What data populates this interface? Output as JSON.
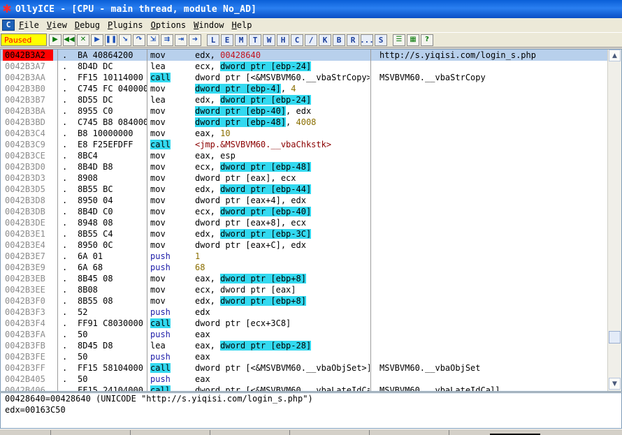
{
  "window": {
    "app_name": "OllyICE",
    "title": "OllyICE - [CPU - main thread, module No_AD]"
  },
  "menu": [
    {
      "label": "File",
      "u": "F",
      "rest": "ile"
    },
    {
      "label": "View",
      "u": "V",
      "rest": "iew"
    },
    {
      "label": "Debug",
      "u": "D",
      "rest": "ebug"
    },
    {
      "label": "Plugins",
      "u": "P",
      "rest": "lugins"
    },
    {
      "label": "Options",
      "u": "O",
      "rest": "ptions"
    },
    {
      "label": "Window",
      "u": "W",
      "rest": "indow"
    },
    {
      "label": "Help",
      "u": "H",
      "rest": "elp"
    }
  ],
  "toolbar": {
    "status": "Paused",
    "buttons": [
      {
        "name": "open-icon",
        "glyph": "▶"
      },
      {
        "name": "restart-icon",
        "glyph": "◀◀"
      },
      {
        "name": "close-icon",
        "glyph": "✕"
      },
      {
        "name": "run-icon",
        "glyph": "▶"
      },
      {
        "name": "pause-icon",
        "glyph": "❚❚"
      },
      {
        "name": "step-into-icon",
        "glyph": "↘"
      },
      {
        "name": "step-over-icon",
        "glyph": "↷"
      },
      {
        "name": "trace-into-icon",
        "glyph": "⇲"
      },
      {
        "name": "trace-over-icon",
        "glyph": "⇉"
      },
      {
        "name": "execute-till-return-icon",
        "glyph": "⇥"
      },
      {
        "name": "goto-icon",
        "glyph": "➜"
      }
    ],
    "letter_buttons": [
      "L",
      "E",
      "M",
      "T",
      "W",
      "H",
      "C",
      "/",
      "K",
      "B",
      "R",
      "...",
      "S"
    ],
    "extra_buttons": [
      {
        "name": "list-icon",
        "glyph": "☰"
      },
      {
        "name": "grid-icon",
        "glyph": "▦"
      },
      {
        "name": "help-icon",
        "glyph": "?"
      }
    ]
  },
  "disasm": [
    {
      "addr": "0042B3A2",
      "mark": ".",
      "hex": "BA 40864200",
      "mn": "mov",
      "ops": [
        {
          "t": "edx, "
        },
        {
          "t": "00428640",
          "c": "num"
        }
      ],
      "comment": "http://s.yiqisi.com/login_s.php",
      "selected": true
    },
    {
      "addr": "0042B3A7",
      "mark": ".",
      "hex": "8D4D DC",
      "mn": "lea",
      "ops": [
        {
          "t": "ecx, "
        },
        {
          "t": "dword ptr [ebp-24]",
          "c": "hl"
        }
      ],
      "comment": ""
    },
    {
      "addr": "0042B3AA",
      "mark": ".",
      "hex": "FF15 10114000",
      "mn": "call",
      "mnc": "call-mn",
      "ops": [
        {
          "t": "dword ptr [<&MSVBVM60.__vbaStrCopy>]"
        }
      ],
      "comment": "MSVBVM60.__vbaStrCopy"
    },
    {
      "addr": "0042B3B0",
      "mark": ".",
      "hex": "C745 FC 04000000",
      "mn": "mov",
      "ops": [
        {
          "t": "dword ptr [ebp-4]",
          "c": "hl"
        },
        {
          "t": ", "
        },
        {
          "t": "4",
          "c": "imm"
        }
      ],
      "comment": ""
    },
    {
      "addr": "0042B3B7",
      "mark": ".",
      "hex": "8D55 DC",
      "mn": "lea",
      "ops": [
        {
          "t": "edx, "
        },
        {
          "t": "dword ptr [ebp-24]",
          "c": "hl"
        }
      ],
      "comment": ""
    },
    {
      "addr": "0042B3BA",
      "mark": ".",
      "hex": "8955 C0",
      "mn": "mov",
      "ops": [
        {
          "t": "dword ptr [ebp-40]",
          "c": "hl"
        },
        {
          "t": ", edx"
        }
      ],
      "comment": ""
    },
    {
      "addr": "0042B3BD",
      "mark": ".",
      "hex": "C745 B8 08400000",
      "mn": "mov",
      "ops": [
        {
          "t": "dword ptr [ebp-48]",
          "c": "hl"
        },
        {
          "t": ", "
        },
        {
          "t": "4008",
          "c": "imm"
        }
      ],
      "comment": ""
    },
    {
      "addr": "0042B3C4",
      "mark": ".",
      "hex": "B8 10000000",
      "mn": "mov",
      "ops": [
        {
          "t": "eax, "
        },
        {
          "t": "10",
          "c": "imm"
        }
      ],
      "comment": ""
    },
    {
      "addr": "0042B3C9",
      "mark": ".",
      "hex": "E8 F25EFDFF",
      "mn": "call",
      "mnc": "call-mn",
      "ops": [
        {
          "t": "<jmp.&MSVBVM60.__vbaChkstk>",
          "c": "jmp-target"
        }
      ],
      "comment": ""
    },
    {
      "addr": "0042B3CE",
      "mark": ".",
      "hex": "8BC4",
      "mn": "mov",
      "ops": [
        {
          "t": "eax, esp"
        }
      ],
      "comment": ""
    },
    {
      "addr": "0042B3D0",
      "mark": ".",
      "hex": "8B4D B8",
      "mn": "mov",
      "ops": [
        {
          "t": "ecx, "
        },
        {
          "t": "dword ptr [ebp-48]",
          "c": "hl"
        }
      ],
      "comment": ""
    },
    {
      "addr": "0042B3D3",
      "mark": ".",
      "hex": "8908",
      "mn": "mov",
      "ops": [
        {
          "t": "dword ptr [eax], ecx"
        }
      ],
      "comment": ""
    },
    {
      "addr": "0042B3D5",
      "mark": ".",
      "hex": "8B55 BC",
      "mn": "mov",
      "ops": [
        {
          "t": "edx, "
        },
        {
          "t": "dword ptr [ebp-44]",
          "c": "hl"
        }
      ],
      "comment": ""
    },
    {
      "addr": "0042B3D8",
      "mark": ".",
      "hex": "8950 04",
      "mn": "mov",
      "ops": [
        {
          "t": "dword ptr [eax+4], edx"
        }
      ],
      "comment": ""
    },
    {
      "addr": "0042B3DB",
      "mark": ".",
      "hex": "8B4D C0",
      "mn": "mov",
      "ops": [
        {
          "t": "ecx, "
        },
        {
          "t": "dword ptr [ebp-40]",
          "c": "hl"
        }
      ],
      "comment": ""
    },
    {
      "addr": "0042B3DE",
      "mark": ".",
      "hex": "8948 08",
      "mn": "mov",
      "ops": [
        {
          "t": "dword ptr [eax+8], ecx"
        }
      ],
      "comment": ""
    },
    {
      "addr": "0042B3E1",
      "mark": ".",
      "hex": "8B55 C4",
      "mn": "mov",
      "ops": [
        {
          "t": "edx, "
        },
        {
          "t": "dword ptr [ebp-3C]",
          "c": "hl"
        }
      ],
      "comment": ""
    },
    {
      "addr": "0042B3E4",
      "mark": ".",
      "hex": "8950 0C",
      "mn": "mov",
      "ops": [
        {
          "t": "dword ptr [eax+C], edx"
        }
      ],
      "comment": ""
    },
    {
      "addr": "0042B3E7",
      "mark": ".",
      "hex": "6A 01",
      "mn": "push",
      "mnc": "push-mn",
      "ops": [
        {
          "t": "1",
          "c": "imm"
        }
      ],
      "comment": ""
    },
    {
      "addr": "0042B3E9",
      "mark": ".",
      "hex": "6A 68",
      "mn": "push",
      "mnc": "push-mn",
      "ops": [
        {
          "t": "68",
          "c": "imm"
        }
      ],
      "comment": ""
    },
    {
      "addr": "0042B3EB",
      "mark": ".",
      "hex": "8B45 08",
      "mn": "mov",
      "ops": [
        {
          "t": "eax, "
        },
        {
          "t": "dword ptr [ebp+8]",
          "c": "hl"
        }
      ],
      "comment": ""
    },
    {
      "addr": "0042B3EE",
      "mark": ".",
      "hex": "8B08",
      "mn": "mov",
      "ops": [
        {
          "t": "ecx, dword ptr [eax]"
        }
      ],
      "comment": ""
    },
    {
      "addr": "0042B3F0",
      "mark": ".",
      "hex": "8B55 08",
      "mn": "mov",
      "ops": [
        {
          "t": "edx, "
        },
        {
          "t": "dword ptr [ebp+8]",
          "c": "hl"
        }
      ],
      "comment": ""
    },
    {
      "addr": "0042B3F3",
      "mark": ".",
      "hex": "52",
      "mn": "push",
      "mnc": "push-mn",
      "ops": [
        {
          "t": "edx"
        }
      ],
      "comment": ""
    },
    {
      "addr": "0042B3F4",
      "mark": ".",
      "hex": "FF91 C8030000",
      "mn": "call",
      "mnc": "call-mn",
      "ops": [
        {
          "t": "dword ptr [ecx+3C8]"
        }
      ],
      "comment": ""
    },
    {
      "addr": "0042B3FA",
      "mark": ".",
      "hex": "50",
      "mn": "push",
      "mnc": "push-mn",
      "ops": [
        {
          "t": "eax"
        }
      ],
      "comment": ""
    },
    {
      "addr": "0042B3FB",
      "mark": ".",
      "hex": "8D45 D8",
      "mn": "lea",
      "ops": [
        {
          "t": "eax, "
        },
        {
          "t": "dword ptr [ebp-28]",
          "c": "hl"
        }
      ],
      "comment": ""
    },
    {
      "addr": "0042B3FE",
      "mark": ".",
      "hex": "50",
      "mn": "push",
      "mnc": "push-mn",
      "ops": [
        {
          "t": "eax"
        }
      ],
      "comment": ""
    },
    {
      "addr": "0042B3FF",
      "mark": ".",
      "hex": "FF15 58104000",
      "mn": "call",
      "mnc": "call-mn",
      "ops": [
        {
          "t": "dword ptr [<&MSVBVM60.__vbaObjSet>]"
        }
      ],
      "comment": "MSVBVM60.__vbaObjSet"
    },
    {
      "addr": "0042B405",
      "mark": ".",
      "hex": "50",
      "mn": "push",
      "mnc": "push-mn",
      "ops": [
        {
          "t": "eax"
        }
      ],
      "comment": ""
    },
    {
      "addr": "0042B406",
      "mark": ".",
      "hex": "FF15 24104000",
      "mn": "call",
      "mnc": "call-mn",
      "ops": [
        {
          "t": "dword ptr [<&MSVBVM60.__vbaLateIdCall>]"
        }
      ],
      "comment": "MSVBVM60.__vbaLateIdCall"
    }
  ],
  "info": {
    "line1": "00428640=00428640 (UNICODE \"http://s.yiqisi.com/login_s.php\")",
    "line2": "edx=00163C50"
  },
  "scrollbar": {
    "up_glyph": "▲",
    "down_glyph": "▼"
  },
  "colors": {
    "selection_row": "#b8d0ec",
    "address_selected_bg": "#ff0000",
    "operand_highlight": "#33d9f0",
    "status_bg": "#ffff00",
    "status_fg": "#ff0000"
  }
}
